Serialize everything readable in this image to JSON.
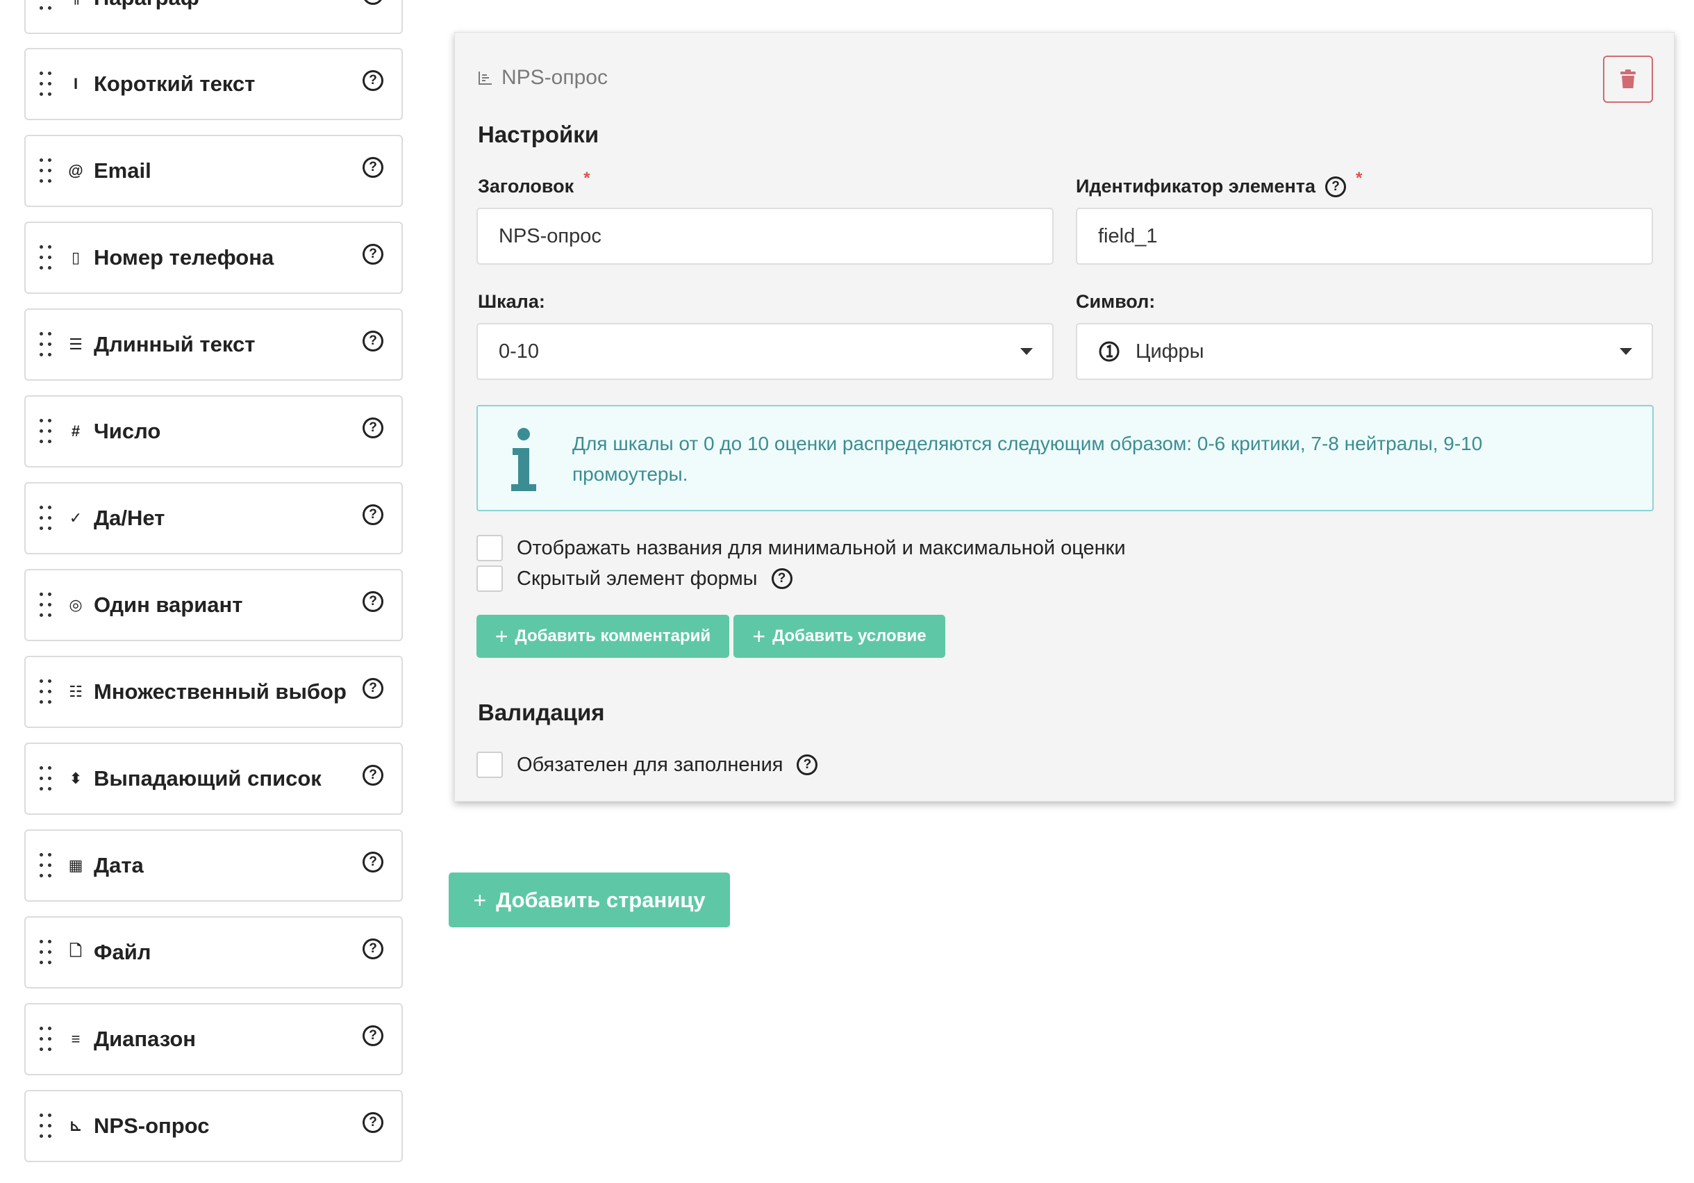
{
  "palette": {
    "items": [
      {
        "label": "Параграф",
        "icon": "paragraph-icon",
        "glyph": "¶"
      },
      {
        "label": "Короткий текст",
        "icon": "text-cursor-icon",
        "glyph": "I"
      },
      {
        "label": "Email",
        "icon": "at-icon",
        "glyph": "@"
      },
      {
        "label": "Номер телефона",
        "icon": "mobile-phone-icon",
        "glyph": "▯"
      },
      {
        "label": "Длинный текст",
        "icon": "text-lines-icon",
        "glyph": "☰"
      },
      {
        "label": "Число",
        "icon": "hash-icon",
        "glyph": "#"
      },
      {
        "label": "Да/Нет",
        "icon": "checkmark-icon",
        "glyph": "✓"
      },
      {
        "label": "Один вариант",
        "icon": "radio-icon",
        "glyph": "◎"
      },
      {
        "label": "Множественный выбор",
        "icon": "checklist-icon",
        "glyph": "☷"
      },
      {
        "label": "Выпадающий список",
        "icon": "sort-arrows-icon",
        "glyph": "⬍"
      },
      {
        "label": "Дата",
        "icon": "calendar-icon",
        "glyph": "▦"
      },
      {
        "label": "Файл",
        "icon": "file-icon",
        "glyph": "🗋"
      },
      {
        "label": "Диапазон",
        "icon": "sliders-icon",
        "glyph": "≡"
      },
      {
        "label": "NPS-опрос",
        "icon": "chart-icon",
        "glyph": "⊾"
      }
    ],
    "help_glyph": "?"
  },
  "editor": {
    "title": "NPS-опрос",
    "title_icon": "chart-icon",
    "delete_icon": "trash-icon",
    "settings_heading": "Настройки",
    "title_field": {
      "label": "Заголовок",
      "required_mark": "*",
      "value": "NPS-опрос"
    },
    "id_field": {
      "label": "Идентификатор элемента",
      "required_mark": "*",
      "value": "field_1"
    },
    "scale_field": {
      "label": "Шкала:",
      "value": "0-10"
    },
    "symbol_field": {
      "label": "Символ:",
      "value": "Цифры",
      "icon": "number-circle-icon"
    },
    "info_text": "Для шкалы от 0 до 10 оценки распределяются следующим образом: 0-6 критики, 7-8 нейтралы, 9-10 промоутеры.",
    "checkboxes": [
      {
        "label": "Отображать названия для минимальной и максимальной оценки",
        "checked": false
      },
      {
        "label": "Скрытый элемент формы",
        "checked": false
      }
    ],
    "buttons": {
      "add_comment": "Добавить комментарий",
      "add_condition": "Добавить условие"
    },
    "validation_heading": "Валидация",
    "required_checkbox": {
      "label": "Обязателен для заполнения",
      "checked": false
    }
  },
  "add_page_label": "Добавить страницу",
  "colors": {
    "accent": "#5ec8a6",
    "info_text": "#3b8d93",
    "danger": "#d06b73"
  }
}
